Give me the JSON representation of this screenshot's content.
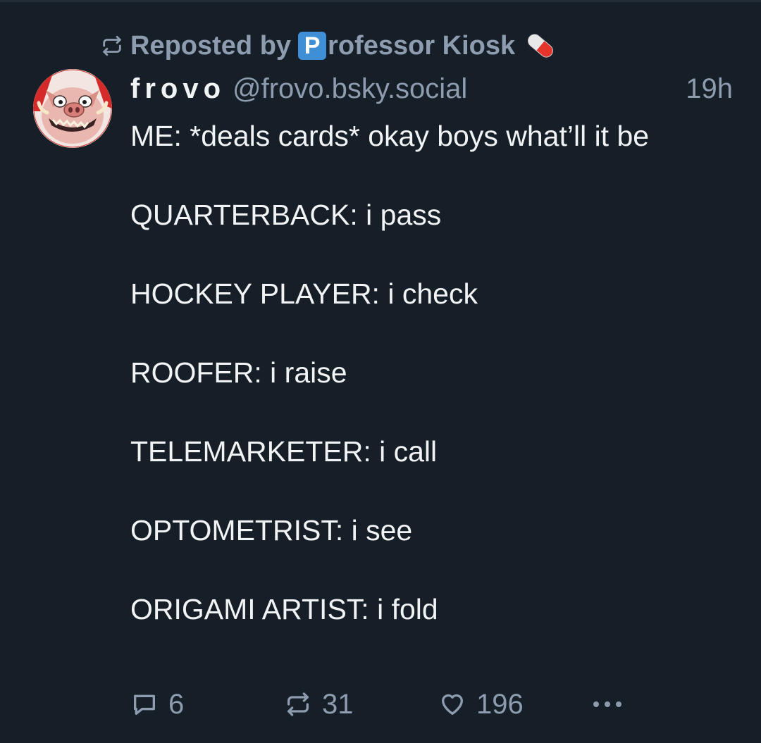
{
  "repost_banner": {
    "label": "Reposted by",
    "reposter_emoji": "P",
    "reposter_name": "rofessor Kiosk",
    "trailing_emoji": "pill-icon"
  },
  "post": {
    "author": {
      "display_name": "frovo",
      "handle": "@frovo.bsky.social",
      "avatar": "pig-face-avatar"
    },
    "timestamp": "19h",
    "text": "ME: *deals cards* okay boys what’ll it be\n\nQUARTERBACK: i pass\n\nHOCKEY PLAYER: i check\n\nROOFER: i raise\n\nTELEMARKETER: i call\n\nOPTOMETRIST: i see\n\nORIGAMI ARTIST: i fold"
  },
  "actions": {
    "reply_count": "6",
    "repost_count": "31",
    "like_count": "196",
    "icons": [
      "reply-bubble-icon",
      "repost-arrows-icon",
      "heart-icon",
      "more-dots-icon"
    ]
  },
  "colors": {
    "background": "#161e27",
    "primary_text": "#f1f3f5",
    "secondary_text": "#8d9cae"
  }
}
